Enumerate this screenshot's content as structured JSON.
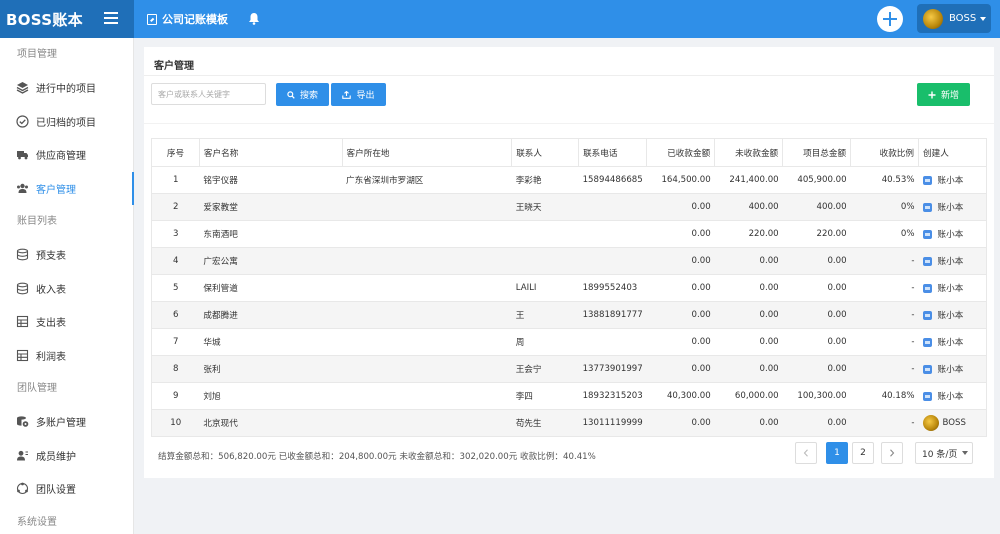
{
  "brand": {
    "name": "BOSS账本"
  },
  "header": {
    "doc_title": "公司记账模板",
    "user_name": "BOSS"
  },
  "sidebar": {
    "items": [
      {
        "type": "section",
        "label": "项目管理"
      },
      {
        "type": "item",
        "label": "进行中的项目",
        "icon": "layers-icon"
      },
      {
        "type": "item",
        "label": "已归档的项目",
        "icon": "check-circle-icon"
      },
      {
        "type": "item",
        "label": "供应商管理",
        "icon": "truck-icon"
      },
      {
        "type": "item",
        "label": "客户管理",
        "icon": "users-icon",
        "active": true
      },
      {
        "type": "section",
        "label": "账目列表"
      },
      {
        "type": "item",
        "label": "预支表",
        "icon": "database-icon"
      },
      {
        "type": "item",
        "label": "收入表",
        "icon": "database-icon"
      },
      {
        "type": "item",
        "label": "支出表",
        "icon": "table-icon"
      },
      {
        "type": "item",
        "label": "利润表",
        "icon": "table-icon"
      },
      {
        "type": "section",
        "label": "团队管理"
      },
      {
        "type": "item",
        "label": "多账户管理",
        "icon": "multi-account-icon"
      },
      {
        "type": "item",
        "label": "成员维护",
        "icon": "members-icon"
      },
      {
        "type": "item",
        "label": "团队设置",
        "icon": "team-settings-icon"
      },
      {
        "type": "section",
        "label": "系统设置"
      }
    ]
  },
  "main": {
    "title": "客户管理",
    "search_placeholder": "客户或联系人关键字",
    "search_label": "搜索",
    "export_label": "导出",
    "new_label": "新增",
    "columns": [
      "序号",
      "客户名称",
      "客户所在地",
      "联系人",
      "联系电话",
      "已收款金额",
      "未收款金额",
      "项目总金额",
      "收款比例",
      "创建人"
    ],
    "rows": [
      {
        "no": "1",
        "name": "铭宇仪器",
        "location": "广东省深圳市罗湖区",
        "contact": "李彩艳",
        "phone": "15894486685",
        "received": "164,500.00",
        "unreceived": "241,400.00",
        "total": "405,900.00",
        "ratio": "40.53%",
        "creator": "账小本",
        "creator_icon": "app-icon"
      },
      {
        "no": "2",
        "name": "爱家教堂",
        "location": "",
        "contact": "王晓天",
        "phone": "",
        "received": "0.00",
        "unreceived": "400.00",
        "total": "400.00",
        "ratio": "0%",
        "creator": "账小本",
        "creator_icon": "app-icon"
      },
      {
        "no": "3",
        "name": "东南酒吧",
        "location": "",
        "contact": "",
        "phone": "",
        "received": "0.00",
        "unreceived": "220.00",
        "total": "220.00",
        "ratio": "0%",
        "creator": "账小本",
        "creator_icon": "app-icon"
      },
      {
        "no": "4",
        "name": "广宏公寓",
        "location": "",
        "contact": "",
        "phone": "",
        "received": "0.00",
        "unreceived": "0.00",
        "total": "0.00",
        "ratio": "-",
        "creator": "账小本",
        "creator_icon": "app-icon"
      },
      {
        "no": "5",
        "name": "保利管道",
        "location": "",
        "contact": "LAILI",
        "phone": "1899552403",
        "received": "0.00",
        "unreceived": "0.00",
        "total": "0.00",
        "ratio": "-",
        "creator": "账小本",
        "creator_icon": "app-icon"
      },
      {
        "no": "6",
        "name": "成都腾进",
        "location": "",
        "contact": "王",
        "phone": "13881891777",
        "received": "0.00",
        "unreceived": "0.00",
        "total": "0.00",
        "ratio": "-",
        "creator": "账小本",
        "creator_icon": "app-icon"
      },
      {
        "no": "7",
        "name": "华城",
        "location": "",
        "contact": "周",
        "phone": "",
        "received": "0.00",
        "unreceived": "0.00",
        "total": "0.00",
        "ratio": "-",
        "creator": "账小本",
        "creator_icon": "app-icon"
      },
      {
        "no": "8",
        "name": "张利",
        "location": "",
        "contact": "王会宁",
        "phone": "13773901997",
        "received": "0.00",
        "unreceived": "0.00",
        "total": "0.00",
        "ratio": "-",
        "creator": "账小本",
        "creator_icon": "app-icon"
      },
      {
        "no": "9",
        "name": "刘旭",
        "location": "",
        "contact": "李四",
        "phone": "18932315203",
        "received": "40,300.00",
        "unreceived": "60,000.00",
        "total": "100,300.00",
        "ratio": "40.18%",
        "creator": "账小本",
        "creator_icon": "app-icon"
      },
      {
        "no": "10",
        "name": "北京现代",
        "location": "",
        "contact": "苟先生",
        "phone": "13011119999",
        "received": "0.00",
        "unreceived": "0.00",
        "total": "0.00",
        "ratio": "-",
        "creator": "BOSS",
        "creator_icon": "avatar"
      }
    ],
    "summary": "结算金额总和：506,820.00元   已收金额总和：204,800.00元   未收金额总和：302,020.00元   收款比例：40.41%",
    "pagination": {
      "pages": [
        "1",
        "2"
      ],
      "current": "1",
      "page_size": "10 条/页"
    }
  },
  "colors": {
    "primary": "#2f8fe8",
    "brand_dark": "#1f6fb8",
    "success": "#19be6b"
  }
}
